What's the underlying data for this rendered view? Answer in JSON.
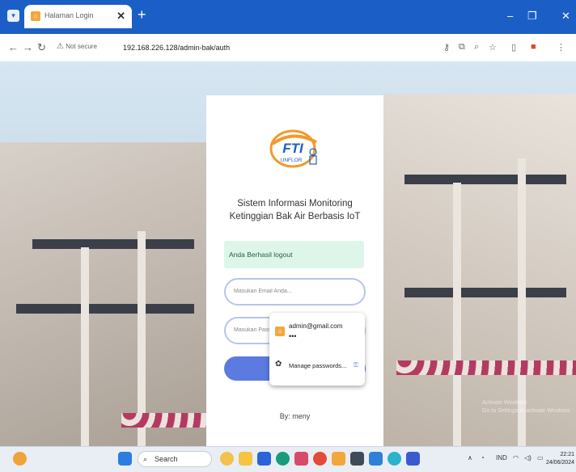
{
  "browser": {
    "tab_title": "Halaman Login",
    "tab_close": "✕",
    "new_tab": "+",
    "security_label": "Not secure",
    "url": "192.168.226.128/admin-bak/auth",
    "minimize": "–",
    "restore": "❐",
    "close": "✕"
  },
  "login": {
    "logo_text": "FTI",
    "logo_subtext": "UNFLOR",
    "title_line1": "Sistem Informasi Monitoring",
    "title_line2": "Ketinggian Bak Air Berbasis IoT",
    "alert": "Anda Berhasil logout",
    "email_placeholder": "Masukan Email Anda...",
    "password_placeholder": "Masukan Password",
    "byline": "By: meny"
  },
  "autofill": {
    "email": "admin@gmail.com",
    "password_mask": "•••",
    "manage_label": "Manage passwords..."
  },
  "watermark": {
    "line1": "Activate Windows",
    "line2": "Go to Settings to activate Windows."
  },
  "taskbar": {
    "search_label": "Search",
    "lang": "IND",
    "time": "22:21",
    "date": "24/06/2024"
  },
  "colors": {
    "titlebar": "#1b5fc6",
    "login_button": "#5b7be0",
    "alert_bg": "#def6ea",
    "logo_orange": "#f29a2e",
    "logo_blue": "#1f5fbf"
  }
}
